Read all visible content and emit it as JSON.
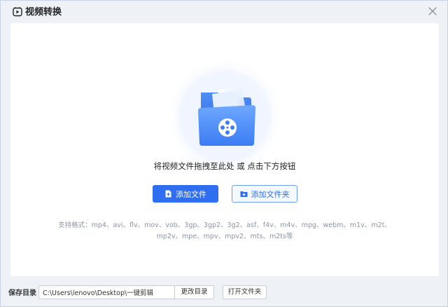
{
  "window": {
    "title": "视频转换",
    "title_icon": "video-convert-icon",
    "close_icon": "close-icon"
  },
  "drop_zone": {
    "illustration": "folder-video-icon",
    "hint": "将视频文件拖拽至此处 或 点击下方按钮"
  },
  "buttons": {
    "add_file": "添加文件",
    "add_file_icon": "add-file-icon",
    "add_folder": "添加文件夹",
    "add_folder_icon": "add-folder-icon"
  },
  "formats": {
    "line1": "支持格式：mp4、avi、flv、mov、vob、3gp、3gp2、3g2、asf、f4v、m4v、mpg、webm、m1v、m2t、",
    "line2": "mp2v、mpe、mpv、mpv2、mts、m2ts等"
  },
  "bottom": {
    "save_label": "保存目录",
    "path_value": "C:\\Users\\lenovo\\Desktop\\一键剪辑",
    "change_dir": "更改目录",
    "open_folder": "打开文件夹"
  },
  "colors": {
    "accent": "#2f6ef0",
    "window_bg": "#eef1f6",
    "panel_bg": "#ffffff",
    "hint_gray": "#8a93a6"
  }
}
